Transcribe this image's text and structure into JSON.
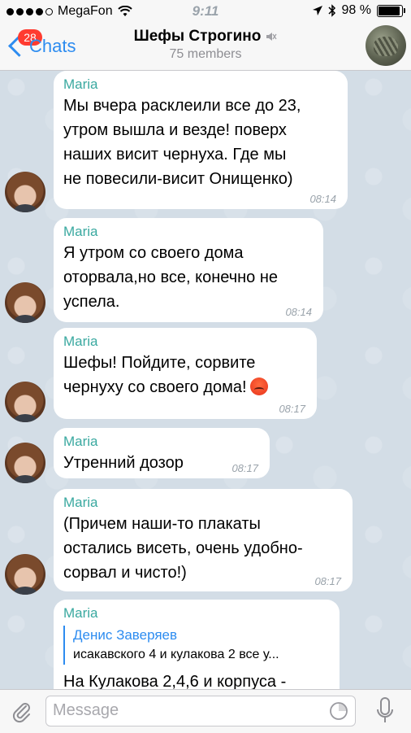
{
  "status_bar": {
    "carrier": "MegaFon",
    "time": "9:11",
    "battery": "98 %"
  },
  "header": {
    "back_label": "Chats",
    "unread_count": "28",
    "title": "Шефы Строгино",
    "subtitle": "75 members"
  },
  "messages": [
    {
      "sender": "Maria",
      "text": "Мы вчера расклеили все до 23,\nутром вышла и везде! поверх\nнаших висит чернуха. Где мы\nне повесили-висит Онищенко)",
      "time": "08:14"
    },
    {
      "sender": "Maria",
      "text": "Я утром со своего дома\nоторвала,но все, конечно не\nуспела.",
      "time": "08:14"
    },
    {
      "sender": "Maria",
      "text": "Шефы! Пойдите, сорвите\nчернуху со своего дома!",
      "time": "08:17"
    },
    {
      "sender": "Maria",
      "text": "Утренний дозор",
      "time": "08:17"
    },
    {
      "sender": "Maria",
      "text": "(Причем наши-то плакаты\nостались висеть, очень удобно-\nсорвал и чисто!)",
      "time": "08:17"
    },
    {
      "sender": "Maria",
      "reply_name": "Денис Заверяев",
      "reply_text": "исакавского 4 и кулакова 2 все у...",
      "text": "На Кулакова 2,4,6 и корпуса -"
    }
  ],
  "input": {
    "placeholder": "Message"
  },
  "colors": {
    "accent": "#2d8cf0",
    "sender_name": "#3aa9a0",
    "badge": "#ff3b30"
  }
}
